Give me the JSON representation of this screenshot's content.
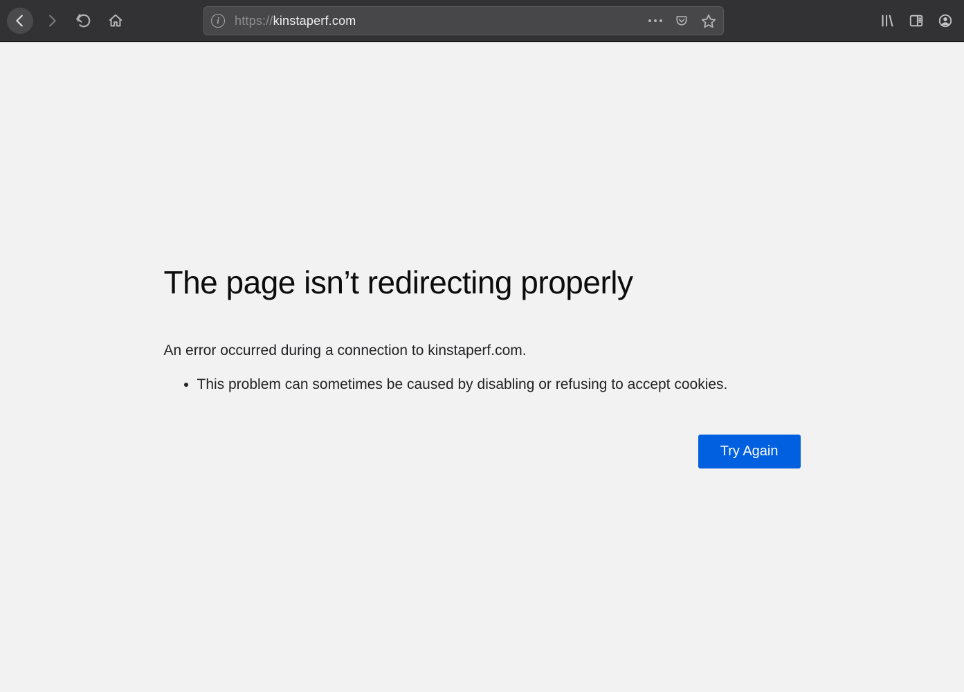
{
  "browser": {
    "url_prefix": "https://",
    "url_host": "kinstaperf.com",
    "url_path": ""
  },
  "error": {
    "title": "The page isn’t redirecting properly",
    "description": "An error occurred during a connection to kinstaperf.com.",
    "causes": [
      "This problem can sometimes be caused by disabling or refusing to accept cookies."
    ],
    "try_again_label": "Try Again"
  }
}
